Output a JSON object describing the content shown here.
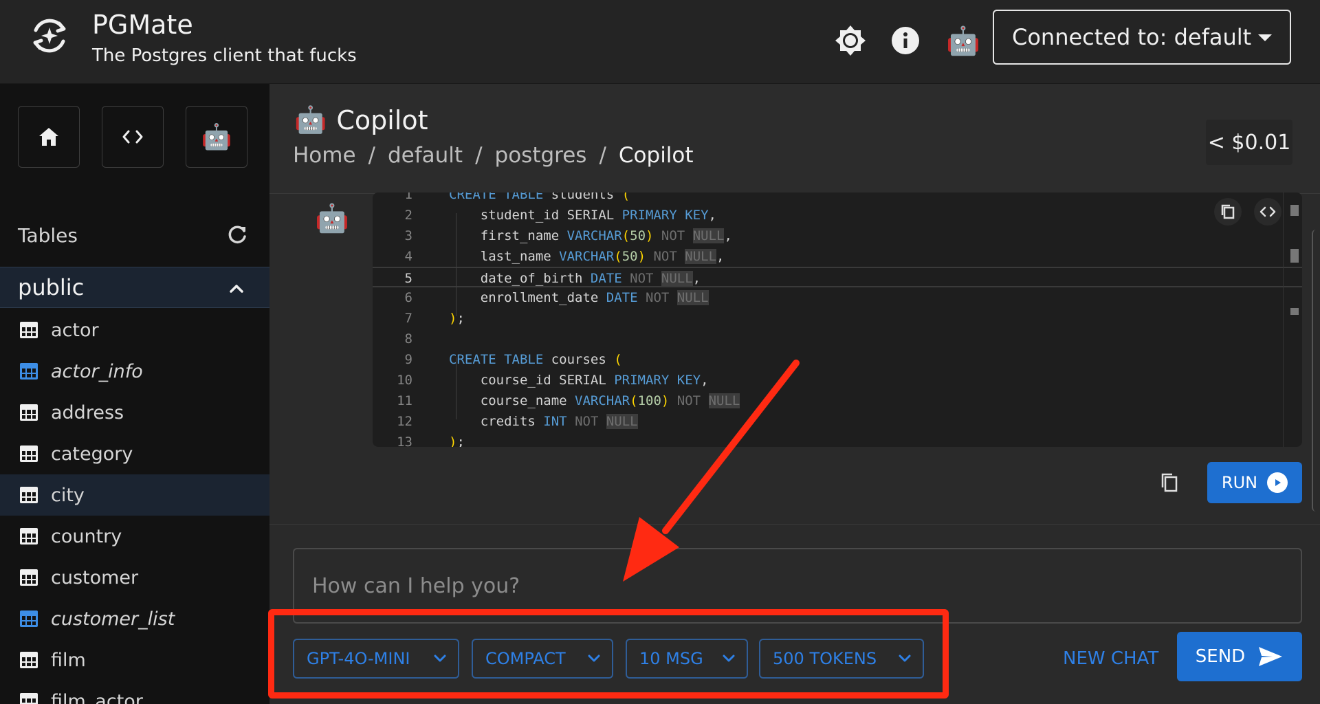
{
  "app": {
    "title": "PGMate",
    "subtitle": "The Postgres client that fucks"
  },
  "topbar": {
    "icons": [
      "theme-toggle-icon",
      "info-icon",
      "robot-icon"
    ],
    "connection_label": "Connected to: default"
  },
  "sidebar": {
    "nav": [
      "home-icon",
      "code-icon",
      "robot-icon"
    ],
    "tables_label": "Tables",
    "schema": "public",
    "tables": [
      {
        "name": "actor",
        "type": "table"
      },
      {
        "name": "actor_info",
        "type": "view"
      },
      {
        "name": "address",
        "type": "table"
      },
      {
        "name": "category",
        "type": "table"
      },
      {
        "name": "city",
        "type": "table",
        "selected": true
      },
      {
        "name": "country",
        "type": "table"
      },
      {
        "name": "customer",
        "type": "table"
      },
      {
        "name": "customer_list",
        "type": "view"
      },
      {
        "name": "film",
        "type": "table"
      },
      {
        "name": "film_actor",
        "type": "table"
      }
    ]
  },
  "page": {
    "emoji": "🤖",
    "title": "Copilot",
    "breadcrumbs": [
      "Home",
      "default",
      "postgres",
      "Copilot"
    ],
    "cost": "< $0.01"
  },
  "code": {
    "line_numbers": [
      "1",
      "2",
      "3",
      "4",
      "5",
      "6",
      "7",
      "8",
      "9",
      "10",
      "11",
      "12",
      "13"
    ],
    "active_line": 5,
    "lines": [
      "CREATE TABLE students (",
      "    student_id SERIAL PRIMARY KEY,",
      "    first_name VARCHAR(50) NOT NULL,",
      "    last_name VARCHAR(50) NOT NULL,",
      "    date_of_birth DATE NOT NULL,",
      "    enrollment_date DATE NOT NULL",
      ");",
      "",
      "CREATE TABLE courses (",
      "    course_id SERIAL PRIMARY KEY,",
      "    course_name VARCHAR(100) NOT NULL",
      "    credits INT NOT NULL",
      ");"
    ],
    "run_label": "RUN"
  },
  "composer": {
    "placeholder": "How can I help you?",
    "model": "GPT-4O-MINI",
    "mode": "COMPACT",
    "messages": "10 MSG",
    "tokens": "500 TOKENS",
    "new_chat_label": "NEW CHAT",
    "send_label": "SEND"
  },
  "colors": {
    "accent": "#1e6fd0",
    "annotation": "#ff2a12"
  }
}
